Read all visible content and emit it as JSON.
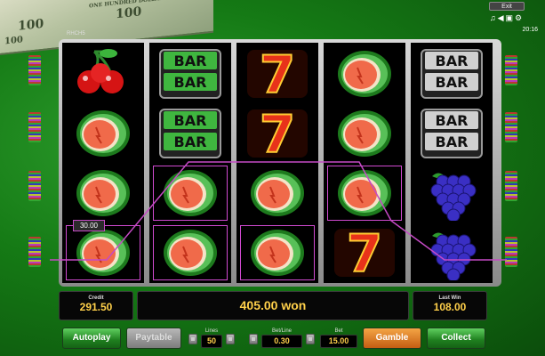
{
  "top": {
    "exit_label": "Exit",
    "icons": [
      "music-note-icon",
      "speaker-icon",
      "fullscreen-icon",
      "settings-icon"
    ],
    "clock": "20:16",
    "game_id": "RHCH5"
  },
  "money": {
    "notes": [
      "ONE HUNDRED DOLLARS",
      "100",
      "100",
      "100"
    ]
  },
  "reels": [
    [
      "cherry",
      "watermelon",
      "watermelon",
      "watermelon"
    ],
    [
      "bar",
      "bar",
      "watermelon",
      "watermelon"
    ],
    [
      "seven",
      "seven",
      "watermelon",
      "watermelon"
    ],
    [
      "watermelon",
      "watermelon",
      "watermelon",
      "seven"
    ],
    [
      "bar",
      "bar",
      "grapes",
      "grapes"
    ]
  ],
  "symbols": {
    "bar_text": "BAR",
    "seven_text": "7"
  },
  "win": {
    "line_win": "30.00"
  },
  "panel": {
    "credit_label": "Credit",
    "credit_value": "291.50",
    "won_text": "405.00 won",
    "last_win_label": "Last Win",
    "last_win_value": "108.00"
  },
  "controls": {
    "autoplay": "Autoplay",
    "paytable": "Paytable",
    "lines_label": "Lines",
    "lines_value": "50",
    "bet_line_label": "Bet/Line",
    "bet_line_value": "0.30",
    "bet_label": "Bet",
    "bet_value": "15.00",
    "gamble": "Gamble",
    "collect": "Collect"
  },
  "colors": {
    "payline": "#c54ac5",
    "value_gold": "#ffd04a",
    "button_green": "#2e9a2e",
    "button_orange": "#e07a20"
  }
}
